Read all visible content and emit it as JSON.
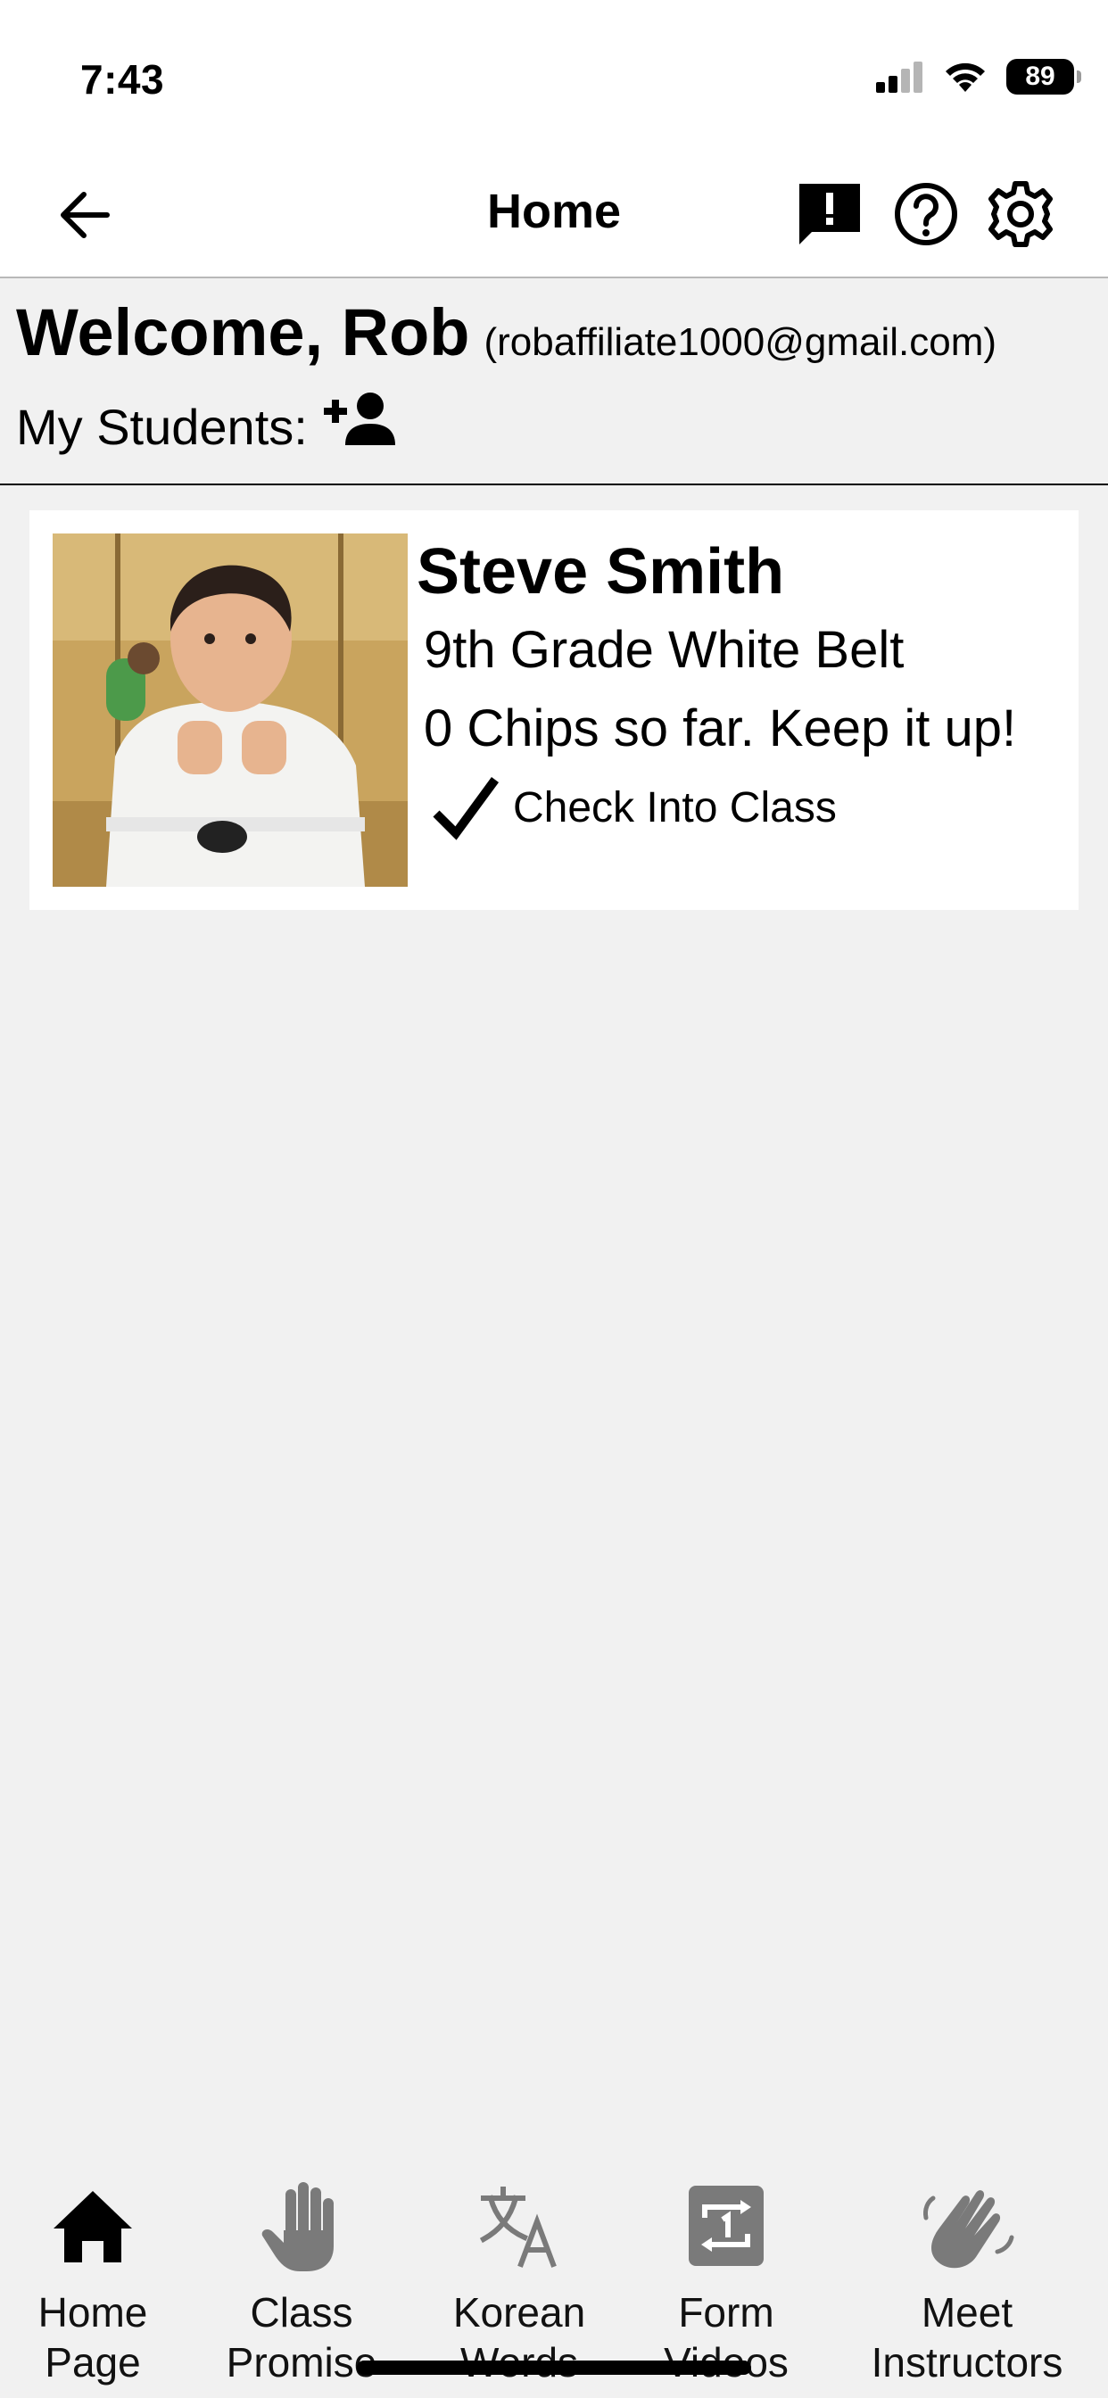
{
  "status_bar": {
    "time": "7:43",
    "battery": "89"
  },
  "header": {
    "title": "Home"
  },
  "welcome": {
    "greeting": "Welcome, Rob",
    "email": "(robaffiliate1000@gmail.com)"
  },
  "students_section": {
    "label": "My Students:"
  },
  "students": [
    {
      "name": "Steve Smith",
      "rank": "9th Grade White Belt",
      "chips_text": "0 Chips so far. Keep it up!",
      "checkin_label": "Check Into Class"
    }
  ],
  "tabs": [
    {
      "line1": "Home",
      "line2": "Page",
      "icon": "home-icon"
    },
    {
      "line1": "Class",
      "line2": "Promise",
      "icon": "hand-icon"
    },
    {
      "line1": "Korean",
      "line2": "Words",
      "icon": "translate-icon"
    },
    {
      "line1": "Form",
      "line2": "Videos",
      "icon": "repeat-one-icon"
    },
    {
      "line1": "Meet",
      "line2": "Instructors",
      "icon": "waving-hand-icon"
    }
  ],
  "colors": {
    "background": "#f1f1f1",
    "active_tab": "#000000",
    "inactive_tab": "#7a7a7a"
  }
}
